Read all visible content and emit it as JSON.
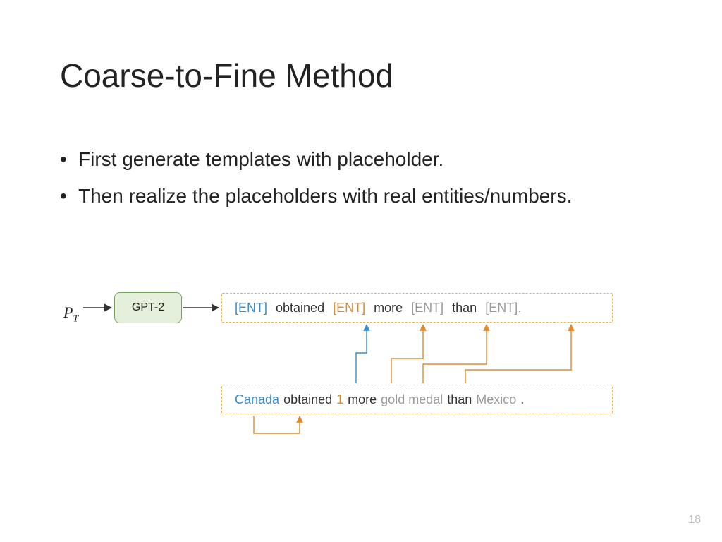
{
  "title": "Coarse-to-Fine Method",
  "bullets": [
    "First generate templates with placeholder.",
    "Then realize the placeholders with real entities/numbers."
  ],
  "pt_symbol": "P",
  "pt_sub": "T",
  "model_box": "GPT-2",
  "template_tokens": [
    {
      "text": "[ENT]",
      "color": "blue"
    },
    {
      "text": "obtained",
      "color": "black"
    },
    {
      "text": "[ENT]",
      "color": "orange"
    },
    {
      "text": "more",
      "color": "black"
    },
    {
      "text": "[ENT]",
      "color": "grey"
    },
    {
      "text": "than",
      "color": "black"
    },
    {
      "text": "[ENT].",
      "color": "grey"
    }
  ],
  "realized_tokens": [
    {
      "text": "Canada",
      "color": "blue"
    },
    {
      "text": "obtained",
      "color": "black"
    },
    {
      "text": "1",
      "color": "orange"
    },
    {
      "text": "more",
      "color": "black"
    },
    {
      "text": "gold medal",
      "color": "grey"
    },
    {
      "text": "than",
      "color": "black"
    },
    {
      "text": "Mexico",
      "color": "grey"
    },
    {
      "text": ".",
      "color": "black"
    }
  ],
  "page_number": "18",
  "colors": {
    "blue": "#3b8bcc",
    "orange": "#e08a2e",
    "grey": "#9a9a9a",
    "black": "#333333",
    "box_border": "#e6b35a",
    "model_fill": "#e4f0dc",
    "model_border": "#7aa060"
  }
}
